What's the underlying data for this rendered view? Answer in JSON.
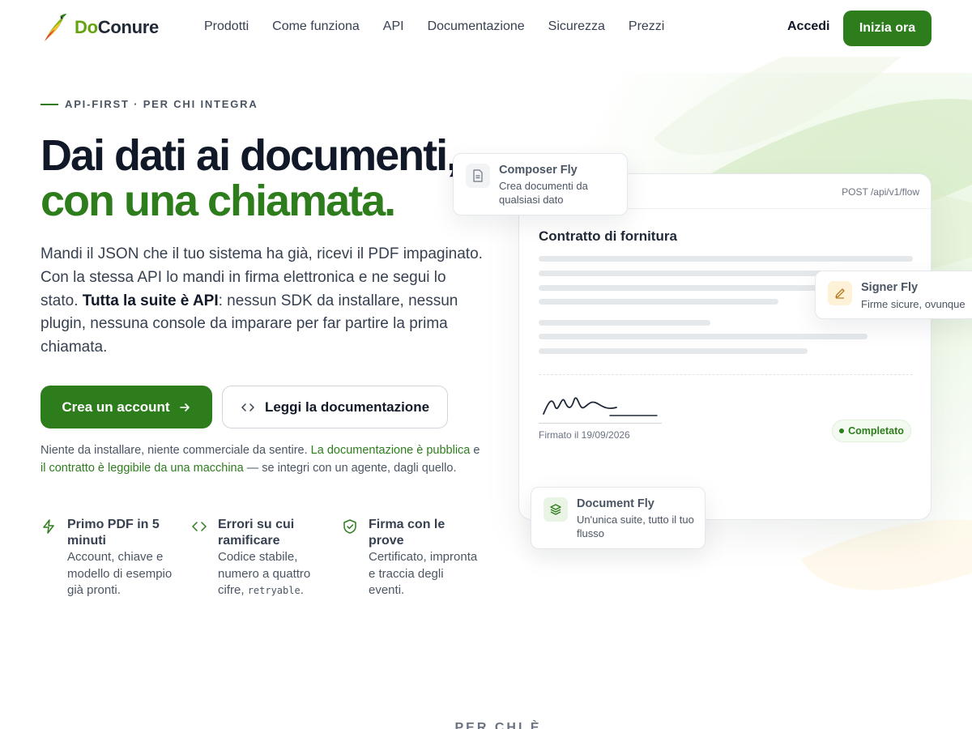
{
  "brand": {
    "name_prefix": "Do",
    "name_rest": "Conure"
  },
  "nav": {
    "items": [
      "Prodotti",
      "Come funziona",
      "API",
      "Documentazione",
      "Sicurezza",
      "Prezzi"
    ],
    "login": "Accedi",
    "cta": "Inizia ora"
  },
  "hero": {
    "eyebrow": "API-FIRST · PER CHI INTEGRA",
    "title_line1": "Dai dati ai documenti,",
    "title_line2": "con una chiamata.",
    "lead_part1": "Mandi il JSON che il tuo sistema ha già, ricevi il PDF impaginato. Con la stessa API lo mandi in firma elettronica e ne segui lo stato. ",
    "lead_bold": "Tutta la suite è API",
    "lead_part2": ": nessun SDK da installare, nessun plugin, nessuna console da imparare per far partire la prima chiamata.",
    "primary_button": "Crea un account",
    "secondary_button": "Leggi la documentazione",
    "note_part1": "Niente da installare, niente commerciale da sentire. ",
    "note_link1": "La documentazione è pubblica",
    "note_part2": " e ",
    "note_link2": "il contratto è leggibile da una macchina",
    "note_part3": " — se integri con un agente, dagli quello."
  },
  "features": [
    {
      "icon": "lightning-icon",
      "title": "Primo PDF in 5 minuti",
      "desc": "Account, chiave e modello di esempio già pronti."
    },
    {
      "icon": "code-icon",
      "title": "Errori su cui ramificare",
      "desc_before": "Codice stabile, numero a quattro cifre, ",
      "desc_code": "retryable",
      "desc_after": "."
    },
    {
      "icon": "shield-check-icon",
      "title": "Firma con le prove",
      "desc": "Certificato, impronta e traccia degli eventi."
    }
  ],
  "mockup": {
    "endpoint": "POST /api/v1/flow",
    "doc_title": "Contratto di fornitura",
    "signed_label": "Firmato il 19/09/2026",
    "status": "Completato",
    "cards": [
      {
        "name": "Composer Fly",
        "desc": "Crea documenti da qualsiasi dato",
        "icon": "document-icon"
      },
      {
        "name": "Signer Fly",
        "desc": "Firme sicure, ovunque",
        "icon": "pen-icon"
      },
      {
        "name": "Document Fly",
        "desc": "Un'unica suite, tutto il tuo flusso",
        "icon": "layers-icon"
      }
    ]
  },
  "next_section": {
    "eyebrow": "PER CHI È"
  },
  "colors": {
    "accent": "#2e7d1d",
    "text": "#111827",
    "muted": "#4b5563"
  }
}
